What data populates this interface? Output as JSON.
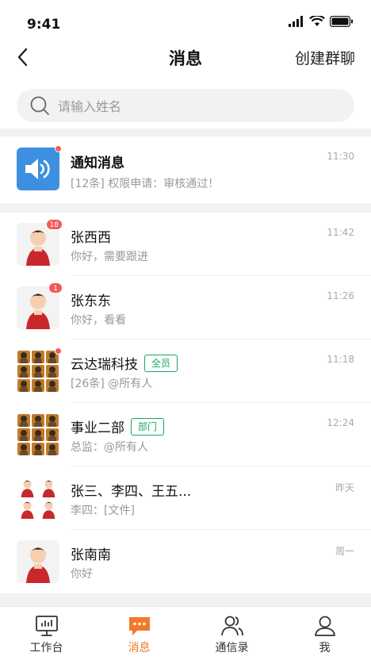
{
  "status_bar": {
    "time": "9:41"
  },
  "nav": {
    "title": "消息",
    "action": "创建群聊"
  },
  "search": {
    "placeholder": "请输入姓名"
  },
  "notice": {
    "name": "通知消息",
    "preview": "[12条] 权限申请：审核通过！",
    "time": "11:30"
  },
  "conversations": [
    {
      "name": "张西西",
      "preview": "你好，需要跟进",
      "time": "11:42",
      "badge": "18"
    },
    {
      "name": "张东东",
      "preview": "你好，看看",
      "time": "11:26",
      "badge": "1"
    },
    {
      "name": "云达瑞科技",
      "tag": "全员",
      "preview": "[26条] @所有人",
      "time": "11:18"
    },
    {
      "name": "事业二部",
      "tag": "部门",
      "preview": "总监：@所有人",
      "time": "12:24"
    },
    {
      "name": "张三、李四、王五...",
      "preview": "李四：[文件]",
      "time": "昨天"
    },
    {
      "name": "张南南",
      "preview": "你好",
      "time": "周一"
    }
  ],
  "tabs": [
    {
      "label": "工作台",
      "icon": "monitor-icon",
      "active": false
    },
    {
      "label": "消息",
      "icon": "message-icon",
      "active": true
    },
    {
      "label": "通信录",
      "icon": "contacts-icon",
      "active": false
    },
    {
      "label": "我",
      "icon": "user-icon",
      "active": false
    }
  ],
  "colors": {
    "accent": "#f07a2a",
    "badge": "#f25a5a",
    "tag": "#1aa760",
    "notice_icon_bg": "#3d8fe0"
  }
}
